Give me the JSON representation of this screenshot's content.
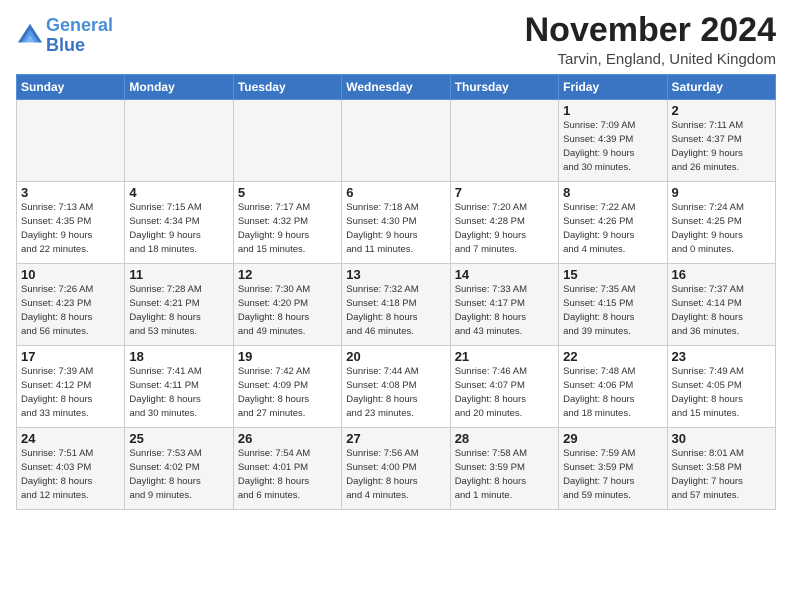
{
  "header": {
    "logo_line1": "General",
    "logo_line2": "Blue",
    "month_title": "November 2024",
    "location": "Tarvin, England, United Kingdom"
  },
  "days_of_week": [
    "Sunday",
    "Monday",
    "Tuesday",
    "Wednesday",
    "Thursday",
    "Friday",
    "Saturday"
  ],
  "weeks": [
    [
      {
        "day": "",
        "info": ""
      },
      {
        "day": "",
        "info": ""
      },
      {
        "day": "",
        "info": ""
      },
      {
        "day": "",
        "info": ""
      },
      {
        "day": "",
        "info": ""
      },
      {
        "day": "1",
        "info": "Sunrise: 7:09 AM\nSunset: 4:39 PM\nDaylight: 9 hours\nand 30 minutes."
      },
      {
        "day": "2",
        "info": "Sunrise: 7:11 AM\nSunset: 4:37 PM\nDaylight: 9 hours\nand 26 minutes."
      }
    ],
    [
      {
        "day": "3",
        "info": "Sunrise: 7:13 AM\nSunset: 4:35 PM\nDaylight: 9 hours\nand 22 minutes."
      },
      {
        "day": "4",
        "info": "Sunrise: 7:15 AM\nSunset: 4:34 PM\nDaylight: 9 hours\nand 18 minutes."
      },
      {
        "day": "5",
        "info": "Sunrise: 7:17 AM\nSunset: 4:32 PM\nDaylight: 9 hours\nand 15 minutes."
      },
      {
        "day": "6",
        "info": "Sunrise: 7:18 AM\nSunset: 4:30 PM\nDaylight: 9 hours\nand 11 minutes."
      },
      {
        "day": "7",
        "info": "Sunrise: 7:20 AM\nSunset: 4:28 PM\nDaylight: 9 hours\nand 7 minutes."
      },
      {
        "day": "8",
        "info": "Sunrise: 7:22 AM\nSunset: 4:26 PM\nDaylight: 9 hours\nand 4 minutes."
      },
      {
        "day": "9",
        "info": "Sunrise: 7:24 AM\nSunset: 4:25 PM\nDaylight: 9 hours\nand 0 minutes."
      }
    ],
    [
      {
        "day": "10",
        "info": "Sunrise: 7:26 AM\nSunset: 4:23 PM\nDaylight: 8 hours\nand 56 minutes."
      },
      {
        "day": "11",
        "info": "Sunrise: 7:28 AM\nSunset: 4:21 PM\nDaylight: 8 hours\nand 53 minutes."
      },
      {
        "day": "12",
        "info": "Sunrise: 7:30 AM\nSunset: 4:20 PM\nDaylight: 8 hours\nand 49 minutes."
      },
      {
        "day": "13",
        "info": "Sunrise: 7:32 AM\nSunset: 4:18 PM\nDaylight: 8 hours\nand 46 minutes."
      },
      {
        "day": "14",
        "info": "Sunrise: 7:33 AM\nSunset: 4:17 PM\nDaylight: 8 hours\nand 43 minutes."
      },
      {
        "day": "15",
        "info": "Sunrise: 7:35 AM\nSunset: 4:15 PM\nDaylight: 8 hours\nand 39 minutes."
      },
      {
        "day": "16",
        "info": "Sunrise: 7:37 AM\nSunset: 4:14 PM\nDaylight: 8 hours\nand 36 minutes."
      }
    ],
    [
      {
        "day": "17",
        "info": "Sunrise: 7:39 AM\nSunset: 4:12 PM\nDaylight: 8 hours\nand 33 minutes."
      },
      {
        "day": "18",
        "info": "Sunrise: 7:41 AM\nSunset: 4:11 PM\nDaylight: 8 hours\nand 30 minutes."
      },
      {
        "day": "19",
        "info": "Sunrise: 7:42 AM\nSunset: 4:09 PM\nDaylight: 8 hours\nand 27 minutes."
      },
      {
        "day": "20",
        "info": "Sunrise: 7:44 AM\nSunset: 4:08 PM\nDaylight: 8 hours\nand 23 minutes."
      },
      {
        "day": "21",
        "info": "Sunrise: 7:46 AM\nSunset: 4:07 PM\nDaylight: 8 hours\nand 20 minutes."
      },
      {
        "day": "22",
        "info": "Sunrise: 7:48 AM\nSunset: 4:06 PM\nDaylight: 8 hours\nand 18 minutes."
      },
      {
        "day": "23",
        "info": "Sunrise: 7:49 AM\nSunset: 4:05 PM\nDaylight: 8 hours\nand 15 minutes."
      }
    ],
    [
      {
        "day": "24",
        "info": "Sunrise: 7:51 AM\nSunset: 4:03 PM\nDaylight: 8 hours\nand 12 minutes."
      },
      {
        "day": "25",
        "info": "Sunrise: 7:53 AM\nSunset: 4:02 PM\nDaylight: 8 hours\nand 9 minutes."
      },
      {
        "day": "26",
        "info": "Sunrise: 7:54 AM\nSunset: 4:01 PM\nDaylight: 8 hours\nand 6 minutes."
      },
      {
        "day": "27",
        "info": "Sunrise: 7:56 AM\nSunset: 4:00 PM\nDaylight: 8 hours\nand 4 minutes."
      },
      {
        "day": "28",
        "info": "Sunrise: 7:58 AM\nSunset: 3:59 PM\nDaylight: 8 hours\nand 1 minute."
      },
      {
        "day": "29",
        "info": "Sunrise: 7:59 AM\nSunset: 3:59 PM\nDaylight: 7 hours\nand 59 minutes."
      },
      {
        "day": "30",
        "info": "Sunrise: 8:01 AM\nSunset: 3:58 PM\nDaylight: 7 hours\nand 57 minutes."
      }
    ]
  ]
}
